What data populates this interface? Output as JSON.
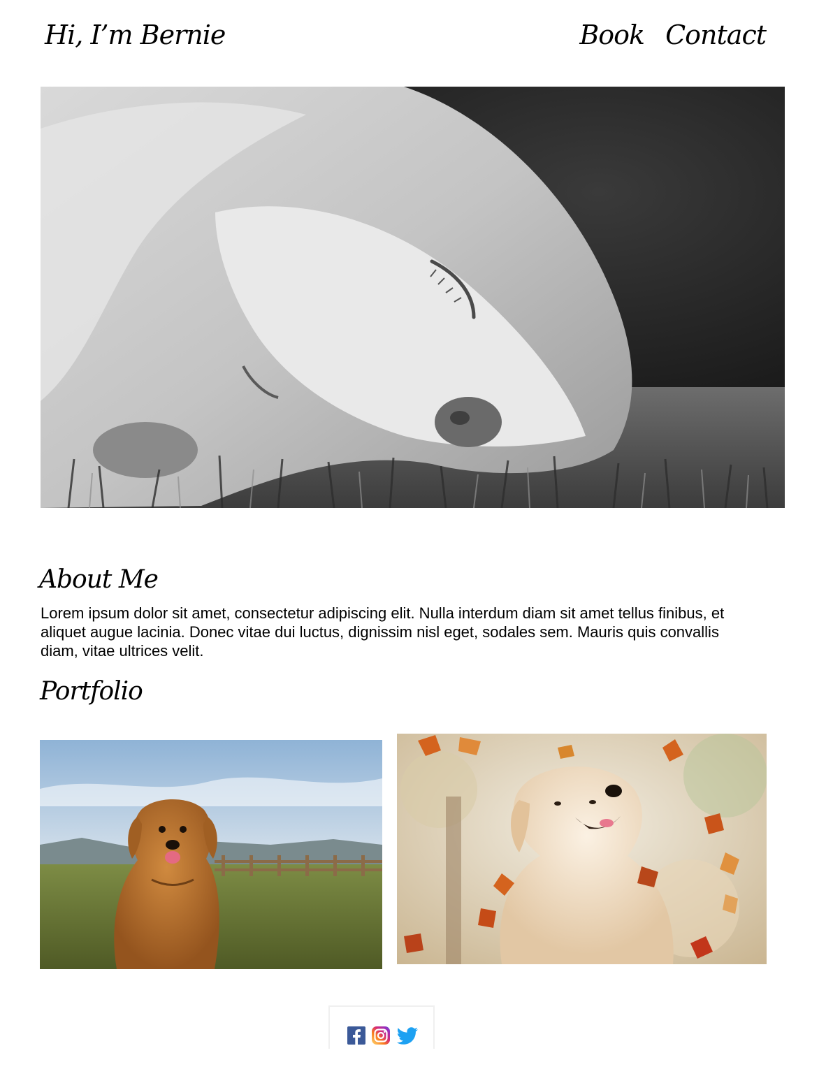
{
  "header": {
    "brand": "Hi, I’m Bernie",
    "nav": [
      {
        "label": "Book"
      },
      {
        "label": "Contact"
      }
    ]
  },
  "hero": {
    "image": "sleeping-dog-grayscale-photo"
  },
  "about": {
    "heading": "About Me",
    "text": "Lorem ipsum dolor sit amet, consectetur adipiscing elit. Nulla interdum diam sit amet tellus finibus, et aliquet augue lacinia. Donec vitae dui luctus, dignissim nisl eget, sodales sem. Mauris quis convallis diam, vitae ultrices velit."
  },
  "portfolio": {
    "heading": "Portfolio",
    "images": [
      "golden-retriever-in-field-photo",
      "golden-retriever-autumn-leaves-photo"
    ]
  },
  "social": {
    "icons": [
      "facebook-icon",
      "instagram-icon",
      "twitter-icon"
    ],
    "colors": {
      "facebook": "#3b5998",
      "twitter": "#1da1f2"
    }
  }
}
